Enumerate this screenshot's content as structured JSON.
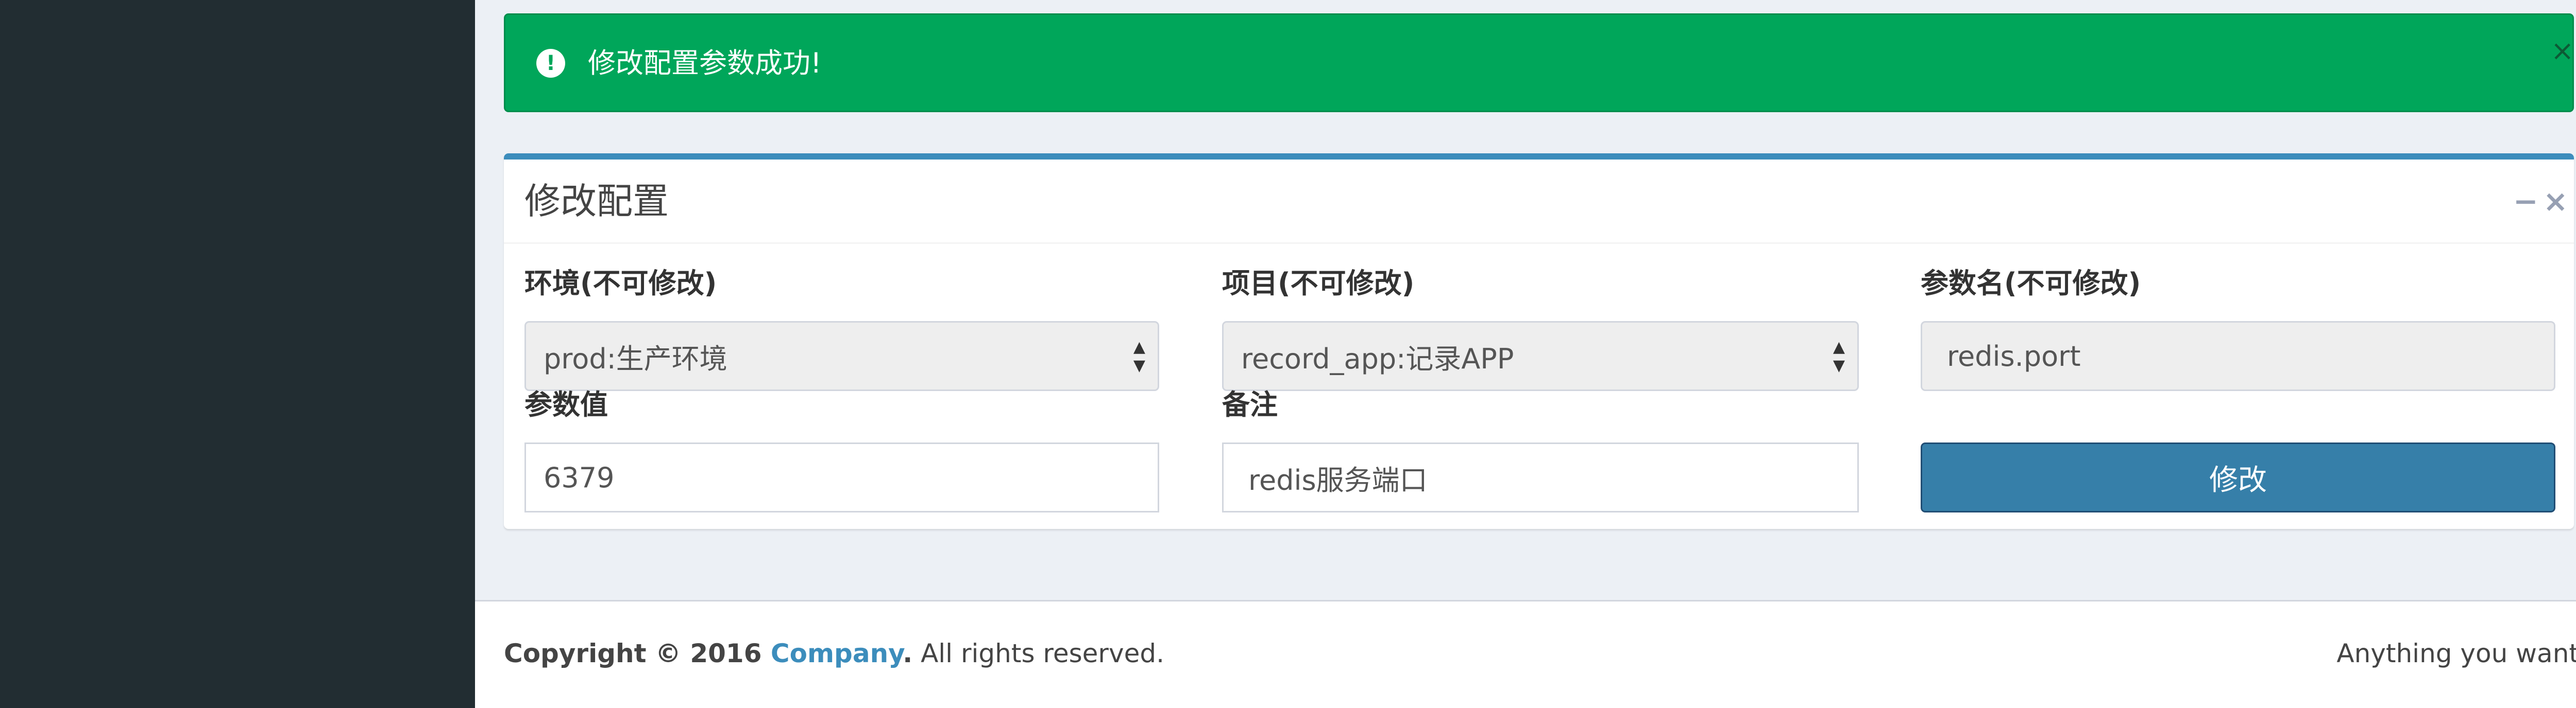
{
  "alert": {
    "icon": "exclamation-circle-icon",
    "message": "修改配置参数成功!",
    "close_symbol": "×",
    "color": "#00a65a"
  },
  "box": {
    "title": "修改配置",
    "minimize_symbol": "−",
    "close_symbol": "×",
    "accent": "#3c8dbc"
  },
  "form": {
    "env": {
      "label": "环境(不可修改)",
      "value": "prod:生产环境"
    },
    "project": {
      "label": "项目(不可修改)",
      "value": "record_app:记录APP"
    },
    "param_name": {
      "label": "参数名(不可修改)",
      "value": "redis.port"
    },
    "param_value": {
      "label": "参数值",
      "value": "6379"
    },
    "remark": {
      "label": "备注",
      "value": "redis服务端口"
    },
    "submit_label": "修改"
  },
  "footer": {
    "copyright_prefix": "Copyright © 2016 ",
    "company": "Company",
    "copyright_suffix": ". All rights reserved.",
    "right_text": "Anything you want"
  }
}
